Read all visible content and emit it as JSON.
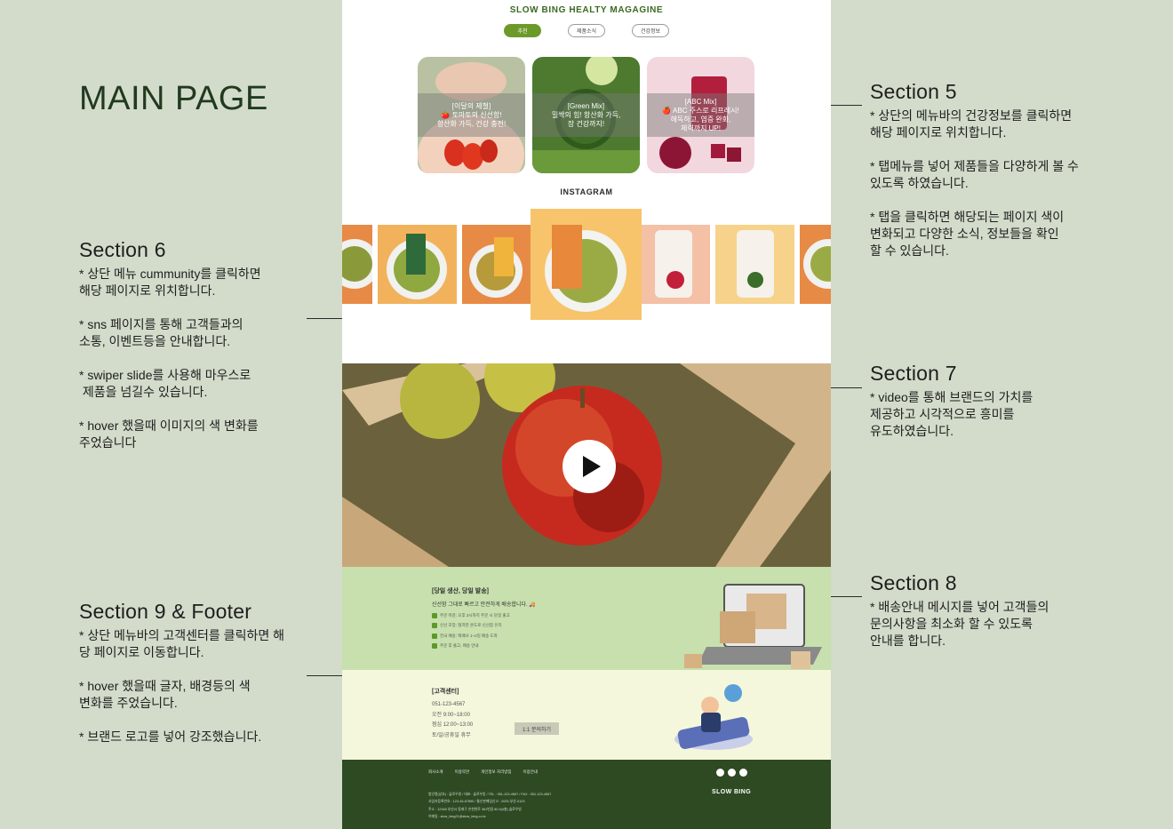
{
  "main_title": "MAIN PAGE",
  "annotations": {
    "s5": {
      "title": "Section 5",
      "lines": [
        "* 상단의 메뉴바의 건강정보를 클릭하면",
        "해당 페이지로 위치합니다.",
        "",
        "* 탭메뉴를 넣어 제품들을 다양하게 볼 수",
        "있도록 하였습니다.",
        "",
        "* 탭을 클릭하면 해당되는 페이지 색이",
        "변화되고 다양한 소식, 정보들을 확인",
        "할 수 있습니다."
      ]
    },
    "s6": {
      "title": "Section 6",
      "lines": [
        "* 상단 메뉴 cummunity를 클릭하면",
        "해당 페이지로 위치합니다.",
        "",
        "* sns 페이지를 통해 고객들과의",
        "소통, 이벤트등을 안내합니다.",
        "",
        "* swiper slide를 사용해 마우스로",
        " 제품을 넘길수 있습니다.",
        "",
        "* hover 했을때 이미지의 색 변화를",
        "주었습니다"
      ]
    },
    "s7": {
      "title": "Section 7",
      "lines": [
        "* video를 통해 브랜드의 가치를",
        "제공하고 시각적으로 흥미를",
        "유도하였습니다."
      ]
    },
    "s8": {
      "title": "Section 8",
      "lines": [
        "* 배송안내 메시지를 넣어 고객들의",
        "문의사항을 최소화 할 수 있도록",
        "안내를 합니다."
      ]
    },
    "s9": {
      "title": "Section 9 & Footer",
      "lines": [
        "* 상단 메뉴바의 고객센터를 클릭하면 해",
        "당 페이지로 이동합니다.",
        "",
        "* hover 했을때 글자, 배경등의 색",
        "변화를 주었습니다.",
        "",
        "* 브랜드 로고를 넣어 강조했습니다."
      ]
    }
  },
  "page": {
    "magazine_title": "SLOW BING HEALTY MAGAGINE",
    "tabs": [
      "추천",
      "제품소식",
      "건강정보"
    ],
    "cards": [
      {
        "caption": "[이달의 제철]\n🍅 토마토의 신선함!\n항산화 가득, 건강 충전!"
      },
      {
        "caption": "[Green Mix]\n밀싹의 힘! 항산화 가득,\n장 건강까지!"
      },
      {
        "caption": "[ABC Mix]\n🍎 ABC 주스로 리프레시!\n해독하고, 염증 완화,\n체력까지 UP!"
      }
    ],
    "instagram_title": "INSTAGRAM",
    "shipping": {
      "title": "[당일 생산, 당일 발송]",
      "subtitle": "신선함 그대로 빠르고 안전하게 배송합니다. 🚚",
      "items": [
        "주문 마감: 오후 3시까지 주문 시 당일 출고",
        "신선 포장: 철저한 온도로 신선함 유지",
        "전국 배송: 택배사 1~2일 배송 도착",
        "주문 후 출고, 배송 안내"
      ]
    },
    "customer_center": {
      "title": "[고객센터]",
      "lines": [
        "051-123-4567",
        "오전 9:00~18:00",
        "점심 12:00~13:00",
        "토/일/공휴일 휴무"
      ],
      "inquiry_button": "1:1 문의하기"
    },
    "footer": {
      "links": [
        "회사소개",
        "이용약관",
        "개인정보 처리방침",
        "이용안내"
      ],
      "logo": "SLOW BING",
      "info": "법인명(상호) : 슬로우빙 / 대표 : 슬로우빙 / TEL : 051-123-4567 / FAX : 051-123-4567\n사업자등록번호 : 123-45-67890 / 통신판매업신고 : 2025-부산-0123\n주소 : 12345 부산시 동래구 온천천로 361번길 80 5(4층) 슬로우빙\n이메일 : slow_bing21@slow_bing.co.kr"
    }
  }
}
